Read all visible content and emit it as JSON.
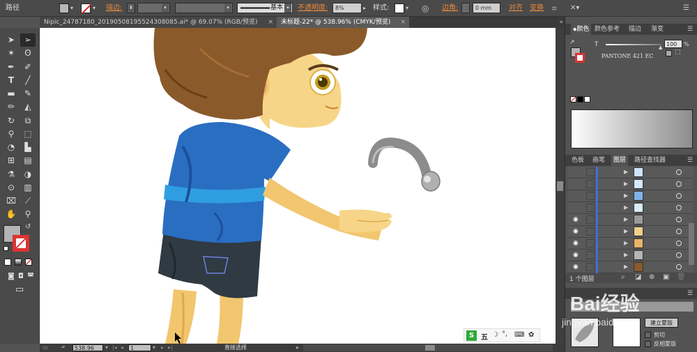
{
  "control_bar": {
    "path_label": "路径",
    "stroke_label": "描边:",
    "stroke_profile": "基本",
    "opacity_label": "不透明度:",
    "opacity_value": "8%",
    "style_label": "样式:",
    "corner_label": "边角:",
    "corner_value": "0 mm",
    "align_label": "对齐",
    "transform_label": "变换"
  },
  "tabs": [
    {
      "label": "Nipic_24787180_20190508195524308085.ai* @ 69.07% (RGB/预览)",
      "active": false
    },
    {
      "label": "未标题-22* @ 538.96% (CMYK/预览)",
      "active": true
    }
  ],
  "status_bar": {
    "zoom": "538.96",
    "page": "1",
    "tool": "直接选择"
  },
  "ime": {
    "label": "五"
  },
  "color_panel": {
    "tabs": [
      "颜色",
      "颜色参考",
      "描边",
      "渐变"
    ],
    "tint_label": "T",
    "tint_value": "100",
    "tint_unit": "%",
    "pantone": "PANTONE 421 EC"
  },
  "layers_panel": {
    "tabs": [
      "色板",
      "画笔",
      "图层",
      "路径查找器"
    ],
    "count_label": "1 个图层",
    "rows": [
      {
        "eye": false,
        "thumb_color": "#cfe3ff"
      },
      {
        "eye": false,
        "thumb_color": "#d6e8ff"
      },
      {
        "eye": false,
        "thumb_color": "#7fb3e6"
      },
      {
        "eye": false,
        "thumb_color": "#d8ecfa"
      },
      {
        "eye": true,
        "thumb_color": "#9a9a9a"
      },
      {
        "eye": true,
        "thumb_color": "#f2d08a"
      },
      {
        "eye": true,
        "thumb_color": "#e9b46a"
      },
      {
        "eye": true,
        "thumb_color": "#b5b5b5"
      },
      {
        "eye": true,
        "thumb_color": "#8a5a2a"
      }
    ]
  },
  "transparency_panel": {
    "clip_label": "剪切",
    "invert_label": "反相蒙版",
    "mask_label": "建立蒙版"
  },
  "watermark": {
    "text": "Bai经验",
    "url": "jingyan.baidu.com"
  },
  "colors": {
    "accent_orange": "#e98a3c",
    "layer_bar_blue": "#3e6fd6"
  }
}
